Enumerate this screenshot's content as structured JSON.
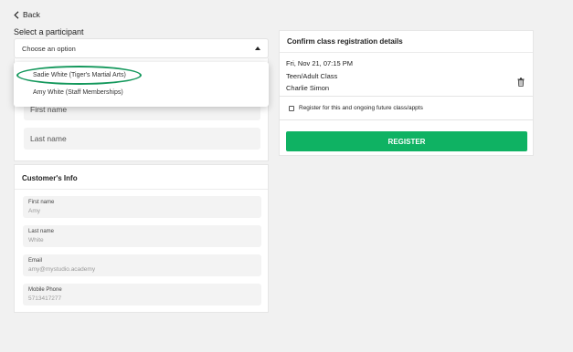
{
  "nav": {
    "back_label": "Back"
  },
  "participant": {
    "label": "Select a participant",
    "placeholder": "Choose an option",
    "options": [
      "Sadie White (Tiger's Martial Arts)",
      "Amy White (Staff Memberships)"
    ],
    "first_name_placeholder": "First name",
    "last_name_placeholder": "Last name"
  },
  "customer_info": {
    "title": "Customer's Info",
    "fields": [
      {
        "label": "First name",
        "value": "Amy"
      },
      {
        "label": "Last name",
        "value": "White"
      },
      {
        "label": "Email",
        "value": "amy@mystudio.academy"
      },
      {
        "label": "Mobile Phone",
        "value": "5713417277"
      }
    ]
  },
  "confirm": {
    "title": "Confirm class registration details",
    "datetime": "Fri, Nov 21, 07:15 PM",
    "class_name": "Teen/Adult Class",
    "instructor": "Charlie Simon",
    "recurring_label": "Register for this and ongoing future class/appts",
    "register_label": "REGISTER"
  },
  "colors": {
    "accent_green": "#0fb263",
    "highlight_ring": "#14985c"
  }
}
